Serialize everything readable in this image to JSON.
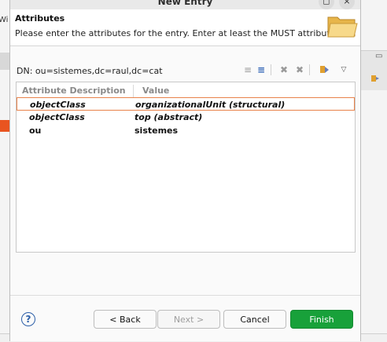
{
  "background": {
    "fragment_text": "Wi",
    "right_min_glyph": "▭"
  },
  "window": {
    "title": "New Entry",
    "maximize_glyph": "◻",
    "close_glyph": "×"
  },
  "header": {
    "title": "Attributes",
    "description": "Please enter the attributes for the entry. Enter at least the MUST attributes."
  },
  "dn": {
    "label": "DN: ou=sistemes,dc=raul,dc=cat"
  },
  "toolbar": {
    "icons": [
      "align-left-icon",
      "align-bold-icon",
      "delete-icon",
      "delete-all-icon",
      "new-attribute-icon",
      "view-menu-icon"
    ]
  },
  "table": {
    "columns": [
      "Attribute Description",
      "Value"
    ],
    "rows": [
      {
        "attribute": "objectClass",
        "value": "organizationalUnit (structural)",
        "italic": true,
        "selected": true
      },
      {
        "attribute": "objectClass",
        "value": "top (abstract)",
        "italic": true,
        "selected": false
      },
      {
        "attribute": "ou",
        "value": "sistemes",
        "italic": false,
        "selected": false
      }
    ]
  },
  "buttons": {
    "help": "?",
    "back": "< Back",
    "next": "Next >",
    "cancel": "Cancel",
    "finish": "Finish"
  },
  "colors": {
    "accent_finish": "#18a13a",
    "selection_border": "#e9824a",
    "ubuntu_orange": "#e95420"
  }
}
